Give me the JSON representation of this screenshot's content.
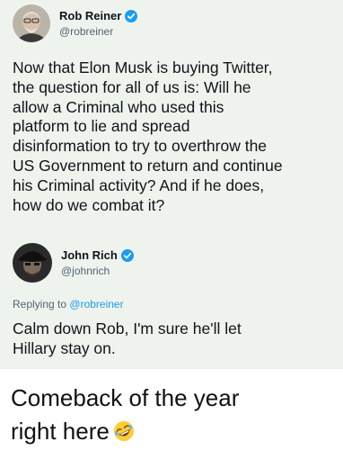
{
  "tweet": {
    "author_name": "Rob Reiner",
    "author_handle": "@robreiner",
    "text": "Now that Elon Musk is buying Twitter,\nthe question for all of us is: Will he\nallow a Criminal who used this\nplatform to lie and spread\ndisinformation to try to overthrow the\nUS Government to return and continue\nhis Criminal activity? And if he does,\nhow do we combat it?"
  },
  "reply": {
    "author_name": "John Rich",
    "author_handle": "@johnrich",
    "replying_to_label": "Replying to",
    "replying_to_handle": "@robreiner",
    "text": "Calm down Rob, I'm sure he'll let\nHillary stay on."
  },
  "caption": {
    "text": "Comeback of the year\nright here",
    "emoji": "rolling-on-floor-laughing-emoji"
  },
  "colors": {
    "verified_badge": "#1d9bf0",
    "handle_text": "#536471",
    "card_background": "#eef3ee"
  },
  "icons": {
    "verified": "verified-badge-icon"
  }
}
